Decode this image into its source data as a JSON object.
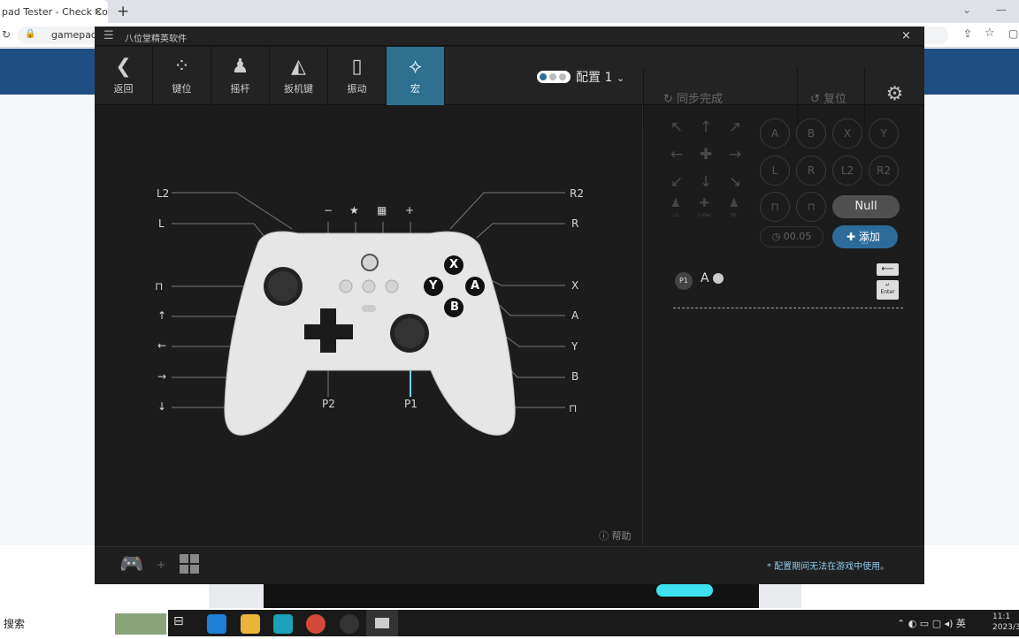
{
  "browser": {
    "tab_title": "pad Tester - Check Cont",
    "address": "gamepad-te",
    "tab_close": "×",
    "new_tab": "+"
  },
  "app": {
    "title": "八位堂精英软件",
    "menu_icon": "☰",
    "close": "×",
    "toolbar": [
      {
        "label": "返回",
        "icon": "back-arrow-icon"
      },
      {
        "label": "键位",
        "icon": "buttons-icon"
      },
      {
        "label": "摇杆",
        "icon": "joystick-icon"
      },
      {
        "label": "扳机键",
        "icon": "trigger-icon"
      },
      {
        "label": "振动",
        "icon": "vibration-icon"
      },
      {
        "label": "宏",
        "icon": "macro-icon",
        "active": true
      }
    ],
    "config_label": "配置 1",
    "sync_label": "同步完成",
    "reset_label": "复位",
    "help_label": "帮助",
    "footer_note": "* 配置期间无法在游戏中使用。",
    "footer_plus": "+"
  },
  "controller": {
    "left_labels": [
      "L2",
      "L",
      "",
      "↑",
      "←",
      "→",
      "↓"
    ],
    "right_labels": [
      "R2",
      "R",
      "X",
      "A",
      "Y",
      "B",
      ""
    ],
    "top_symbols": [
      "−",
      "★",
      "▦",
      "+"
    ],
    "bottom_labels": [
      "P2",
      "P1"
    ],
    "face_buttons": [
      "X",
      "Y",
      "A",
      "B"
    ]
  },
  "macro_panel": {
    "buttons_row1": [
      "A",
      "B",
      "X",
      "Y"
    ],
    "buttons_row2": [
      "L",
      "R",
      "L2",
      "R2"
    ],
    "small_labels": [
      "LS",
      "D-Pad",
      "RS"
    ],
    "null_label": "Null",
    "add_label": "添加",
    "timer": "00.05",
    "entry_badge": "P1",
    "entry_key": "A",
    "enter_label": "Enter"
  },
  "taskbar": {
    "search": "搜索",
    "ime": "英",
    "time": "11:1",
    "date": "2023/3"
  },
  "colors": {
    "accent": "#2f6f8f",
    "add_button": "#2d6c9a",
    "app_bg": "#1c1c1c",
    "page_header": "#1f4f82"
  }
}
